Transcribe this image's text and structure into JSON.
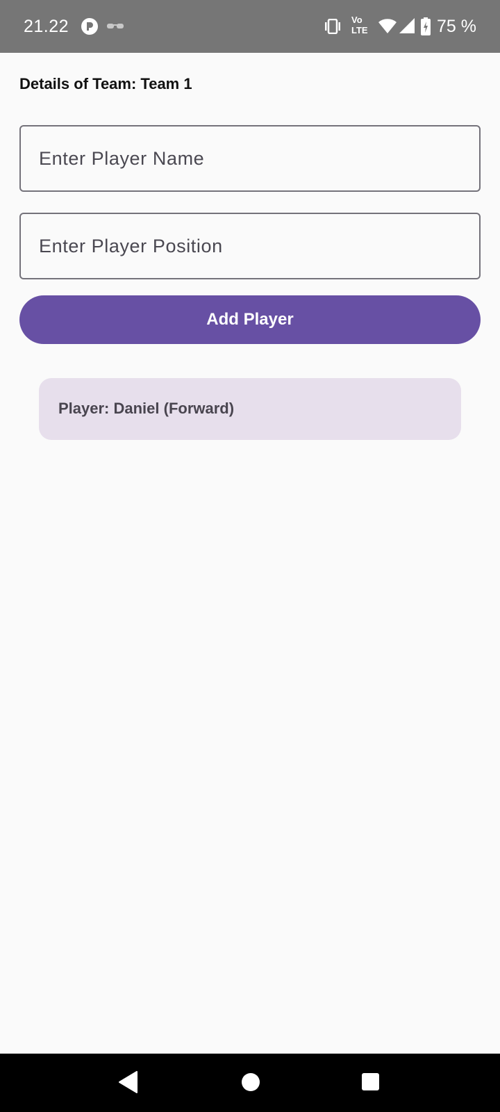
{
  "status_bar": {
    "time": "21.22",
    "icons_left": [
      "app-notification-icon",
      "incognito-glasses-icon"
    ],
    "icons_right": [
      "vibrate-icon",
      "volte-icon",
      "wifi-icon",
      "cellular-signal-icon",
      "battery-charging-icon"
    ],
    "volte_label_top": "Vo",
    "volte_label_bottom": "LTE",
    "battery_text": "75 %"
  },
  "page": {
    "title": "Details of Team: Team 1"
  },
  "form": {
    "name_input": {
      "placeholder": "Enter Player Name",
      "value": ""
    },
    "position_input": {
      "placeholder": "Enter Player Position",
      "value": ""
    },
    "add_button_label": "Add Player"
  },
  "players": [
    {
      "text": "Player: Daniel (Forward)"
    }
  ],
  "colors": {
    "accent": "#6750a4",
    "card_bg": "#e7dfec",
    "status_bar": "#767676",
    "nav_bar": "#000000"
  },
  "nav_bar": {
    "buttons": [
      "back-icon",
      "home-icon",
      "recents-icon"
    ]
  }
}
